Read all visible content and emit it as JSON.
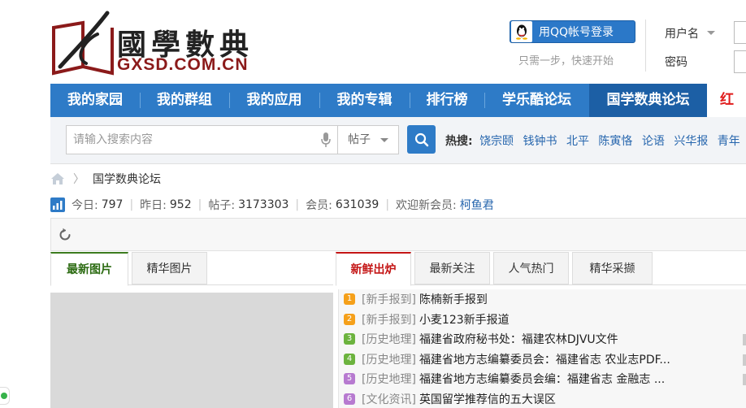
{
  "header": {
    "logo_text": "國學數典",
    "logo_domain": "GXSD.COM.CN",
    "qq_login_label": "用QQ帐号登录",
    "qq_login_sub": "只需一步，快速开始",
    "username_label": "用户名",
    "password_label": "密码"
  },
  "nav": {
    "items": [
      "我的家园",
      "我的群组",
      "我的应用",
      "我的专辑",
      "排行榜",
      "学乐酷论坛",
      "国学数典论坛",
      "红创"
    ],
    "active_index": 6
  },
  "search": {
    "placeholder": "请输入搜索内容",
    "type_selected": "帖子",
    "hot_label": "热搜:",
    "hot_terms": [
      "饶宗颐",
      "钱钟书",
      "北平",
      "陈寅恪",
      "论语",
      "兴华报",
      "青年"
    ]
  },
  "breadcrumb": {
    "current": "国学数典论坛"
  },
  "stats": {
    "today_label": "今日:",
    "today": "797",
    "yesterday_label": "昨日:",
    "yesterday": "952",
    "posts_label": "帖子:",
    "posts": "3173303",
    "members_label": "会员:",
    "members": "631039",
    "welcome_label": "欢迎新会员:",
    "new_member": "柯鱼君"
  },
  "left_panel": {
    "tabs": [
      "最新图片",
      "精华图片"
    ]
  },
  "right_panel": {
    "tabs": [
      "新鲜出炉",
      "最新关注",
      "人气热门",
      "精华采撷"
    ],
    "rows": [
      {
        "rank": "1",
        "color": "#f5a01a",
        "category": "[新手报到]",
        "title": "陈楠新手报到"
      },
      {
        "rank": "2",
        "color": "#f5a01a",
        "category": "[新手报到]",
        "title": "小麦123新手报道"
      },
      {
        "rank": "3",
        "color": "#6cb33e",
        "category": "[历史地理]",
        "title": "福建省政府秘书处：福建农林DJVU文件"
      },
      {
        "rank": "4",
        "color": "#6cb33e",
        "category": "[历史地理]",
        "title": "福建省地方志编纂委员会：福建省志 农业志PDF..."
      },
      {
        "rank": "5",
        "color": "#b77ad0",
        "category": "[历史地理]",
        "title": "福建省地方志编纂委员会编：福建省志 金融志 ..."
      },
      {
        "rank": "6",
        "color": "#b77ad0",
        "category": "[文化资讯]",
        "title": "英国留学推荐信的五大误区"
      }
    ]
  }
}
